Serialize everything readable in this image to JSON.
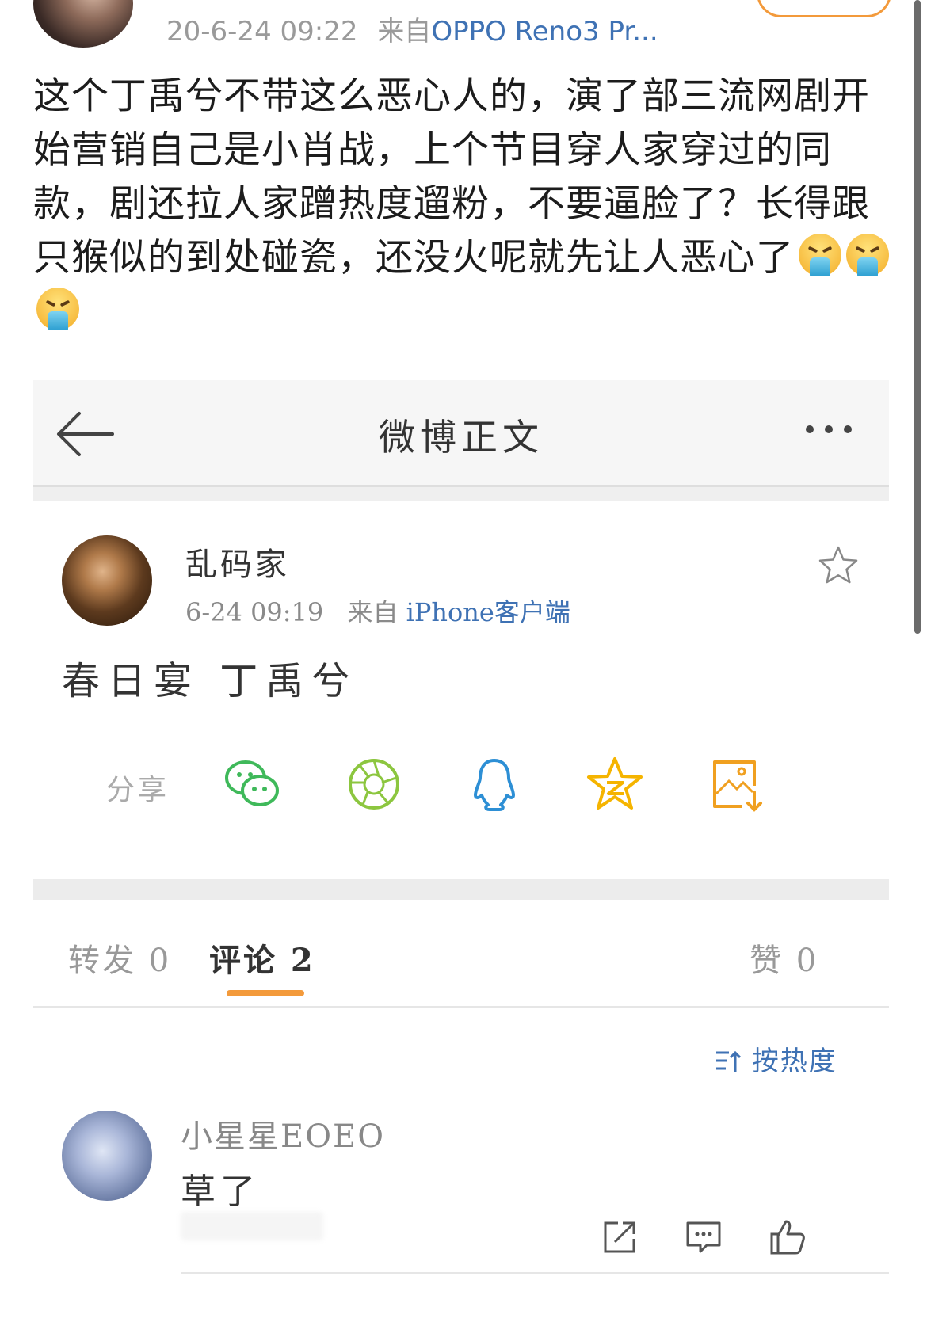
{
  "outer_post": {
    "timestamp": "20-6-24 09:22",
    "source_prefix": "来自",
    "source": "OPPO Reno3 Pr...",
    "text": "这个丁禹兮不带这么恶心人的，演了部三流网剧开始营销自己是小肖战，上个节目穿人家穿过的同款，剧还拉人家蹭热度遛粉，不要逼脸了？长得跟只猴似的到处碰瓷，还没火呢就先让人恶心了",
    "emojis": [
      "vomit-emoji",
      "vomit-emoji",
      "vomit-emoji"
    ]
  },
  "inner": {
    "nav": {
      "title": "微博正文"
    },
    "author": {
      "name": "乱码家",
      "time": "6-24 09:19",
      "source_prefix": "来自",
      "client": "iPhone客户端"
    },
    "post_text": "春日宴 丁禹兮",
    "share": {
      "label": "分享",
      "icons": [
        "wechat-icon",
        "moments-icon",
        "qq-icon",
        "qzone-icon",
        "save-image-icon"
      ]
    },
    "tabs": {
      "repost": "转发 0",
      "comments": "评论 2",
      "likes": "赞 0"
    },
    "sort_label": "按热度",
    "comment": {
      "user": "小星星EOEO",
      "text": "草了"
    }
  },
  "colors": {
    "accent": "#f39a3b",
    "link": "#3f72b4",
    "wechat": "#3fb95a",
    "moments": "#8cc63f",
    "qq": "#2d8fd5",
    "qzone": "#f5b400",
    "save": "#f0a020"
  }
}
